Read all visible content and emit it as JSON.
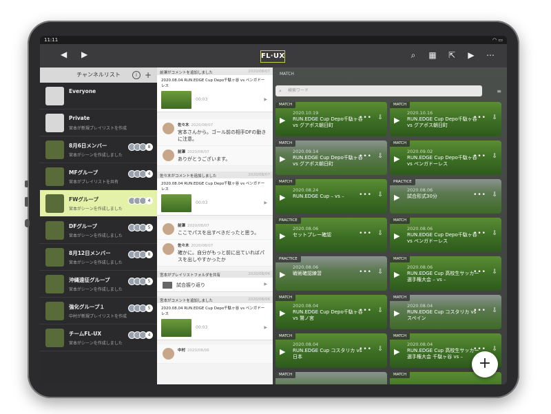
{
  "status": {
    "time": "11:11",
    "wifi_icon": "wifi-icon",
    "battery_icon": "battery-icon"
  },
  "toolbar": {
    "logo": "FL·UX",
    "back_icon": "chevron-left-icon",
    "forward_icon": "chevron-right-icon"
  },
  "channels": {
    "title": "チャンネルリスト",
    "items": [
      {
        "name": "Everyone",
        "sub": "",
        "count": ""
      },
      {
        "name": "Private",
        "sub": "宮本が新規プレイリストを作成",
        "count": ""
      },
      {
        "name": "8月6日メンバー",
        "sub": "宮本がシーンを作成しました",
        "count": "8"
      },
      {
        "name": "MFグループ",
        "sub": "宮本がプレイリストを共有",
        "count": "4"
      },
      {
        "name": "FWグループ",
        "sub": "宮本がシーンを作成しました",
        "count": "4"
      },
      {
        "name": "DFグループ",
        "sub": "宮本がシーンを作成しました",
        "count": "5"
      },
      {
        "name": "8月12日メンバー",
        "sub": "宮本がシーンを作成しました",
        "count": "8"
      },
      {
        "name": "沖縄遠征グループ",
        "sub": "宮本がシーンを作成しました",
        "count": "5"
      },
      {
        "name": "強化グループ１",
        "sub": "中村が新規プレイリストを作成",
        "count": "5"
      },
      {
        "name": "チームFL-UX",
        "sub": "宮本がシーンを作成しました",
        "count": "4"
      }
    ]
  },
  "activity": {
    "blocks": [
      {
        "head": "前澤がコメントを追加しました",
        "date": "2020/08/07",
        "title": "2020.08.04 RUN.EDGE Cup Depo千駄ヶ谷 vs ペンガドーレス",
        "duration": "00:03"
      },
      {
        "head": "佐々木がコメントを追加しました",
        "date": "2020/08/07",
        "title": "2020.08.04 RUN.EDGE Cup Depo千駄ヶ谷 vs ペンガドーレス",
        "duration": "00:03"
      },
      {
        "head": "宮本がプレイリストフォルダを共有",
        "date": "2020/08/06",
        "folder": "試合振り返り"
      },
      {
        "head": "宮本がコメントを追加しました",
        "date": "2020/08/06",
        "title": "2020.08.04 RUN.EDGE Cup Depo千駄ヶ谷 vs ペンガドーレス",
        "duration": "00:03"
      }
    ],
    "comments1": [
      {
        "name": "佐々木",
        "date": "2020/08/07",
        "text": "宮本さんから。ゴール前の相手DFの動きに注意。"
      },
      {
        "name": "前澤",
        "date": "2020/08/07",
        "text": "ありがとうございます。"
      }
    ],
    "comments2": [
      {
        "name": "前澤",
        "date": "2020/08/07",
        "text": "ここでパスを出すべきだったと思う。"
      },
      {
        "name": "佐々木",
        "date": "2020/08/07",
        "text": "確かに。自分がもっと前に出ていればパスを出しやすかったか"
      }
    ],
    "last_comment": {
      "name": "中村",
      "date": "2020/08/06"
    }
  },
  "match": {
    "title": "MATCH",
    "search_placeholder": "検索ワード",
    "tiles": [
      {
        "tag": "MATCH",
        "date": "2020.10.19",
        "title": "RUN.EDGE Cup Depo千駄ヶ谷 vs グアポス朝日町"
      },
      {
        "tag": "MATCH",
        "date": "2020.10.16",
        "title": "RUN.EDGE Cup Depo千駄ヶ谷 vs グアポス朝日町"
      },
      {
        "tag": "MATCH",
        "date": "2020.09.14",
        "title": "RUN.EDGE Cup Depo千駄ヶ谷 vs グアポス朝日町"
      },
      {
        "tag": "MATCH",
        "date": "2020.09.02",
        "title": "RUN.EDGE Cup Depo千駄ヶ谷 vs ペンガドーレス"
      },
      {
        "tag": "MATCH",
        "date": "2020.08.24",
        "title": "RUN.EDGE Cup – vs –"
      },
      {
        "tag": "PRACTICE",
        "date": "2020.08.06",
        "title": "試合形式30分"
      },
      {
        "tag": "PRACTICE",
        "date": "2020.08.06",
        "title": "セットプレー確認"
      },
      {
        "tag": "MATCH",
        "date": "2020.08.06",
        "title": "RUN.EDGE Cup Depo千駄ヶ谷 vs ペンガドーレス"
      },
      {
        "tag": "PRACTICE",
        "date": "2020.08.06",
        "title": "戦術確認練習"
      },
      {
        "tag": "MATCH",
        "date": "2020.08.06",
        "title": "RUN.EDGE Cup 高校生サッカー選手権大会 – vs –"
      },
      {
        "tag": "MATCH",
        "date": "2020.08.04",
        "title": "RUN.EDGE Cup Depo千駄ヶ谷 vs 鷲ノ宮"
      },
      {
        "tag": "MATCH",
        "date": "2020.08.04",
        "title": "RUN.EDGE Cup コスタリカ vs スペイン"
      },
      {
        "tag": "MATCH",
        "date": "2020.08.04",
        "title": "RUN.EDGE Cup コスタリカ vs 日本"
      },
      {
        "tag": "MATCH",
        "date": "2020.08.04",
        "title": "RUN.EDGE Cup 高校生サッカー選手権大会 千駄ヶ谷 vs –"
      },
      {
        "tag": "MATCH",
        "date": "",
        "title": ""
      },
      {
        "tag": "MATCH",
        "date": "",
        "title": ""
      }
    ]
  },
  "fab": {
    "label": "+"
  }
}
